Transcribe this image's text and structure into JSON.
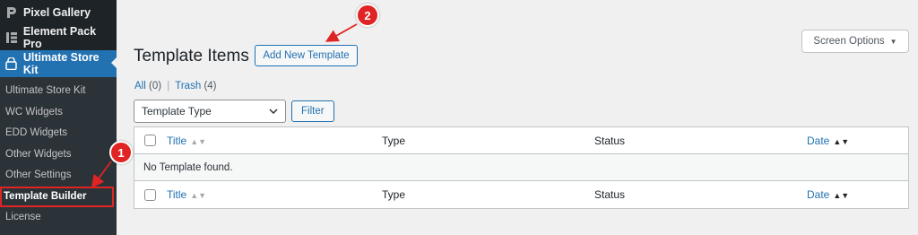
{
  "sidebar": {
    "top_items": [
      {
        "label": "Pixel Gallery",
        "icon": "pixel-gallery-icon"
      },
      {
        "label": "Element Pack Pro",
        "icon": "element-pack-icon"
      },
      {
        "label": "Ultimate Store Kit",
        "icon": "store-bag-icon"
      }
    ],
    "submenu": [
      {
        "label": "Ultimate Store Kit"
      },
      {
        "label": "WC Widgets"
      },
      {
        "label": "EDD Widgets"
      },
      {
        "label": "Other Widgets"
      },
      {
        "label": "Other Settings"
      },
      {
        "label": "Template Builder"
      },
      {
        "label": "License"
      }
    ]
  },
  "header": {
    "title": "Template Items",
    "add_new_label": "Add New Template",
    "screen_options_label": "Screen Options"
  },
  "views": {
    "all_label": "All",
    "all_count": "(0)",
    "separator": "|",
    "trash_label": "Trash",
    "trash_count": "(4)"
  },
  "filters": {
    "select_value": "Template Type",
    "filter_label": "Filter"
  },
  "table": {
    "columns": {
      "title": "Title",
      "type": "Type",
      "status": "Status",
      "date": "Date"
    },
    "empty_message": "No Template found."
  },
  "annotations": {
    "badge1": "1",
    "badge2": "2"
  },
  "colors": {
    "accent": "#2271b1",
    "sidebar_bg": "#1d2327",
    "annotation_red": "#e02424"
  }
}
